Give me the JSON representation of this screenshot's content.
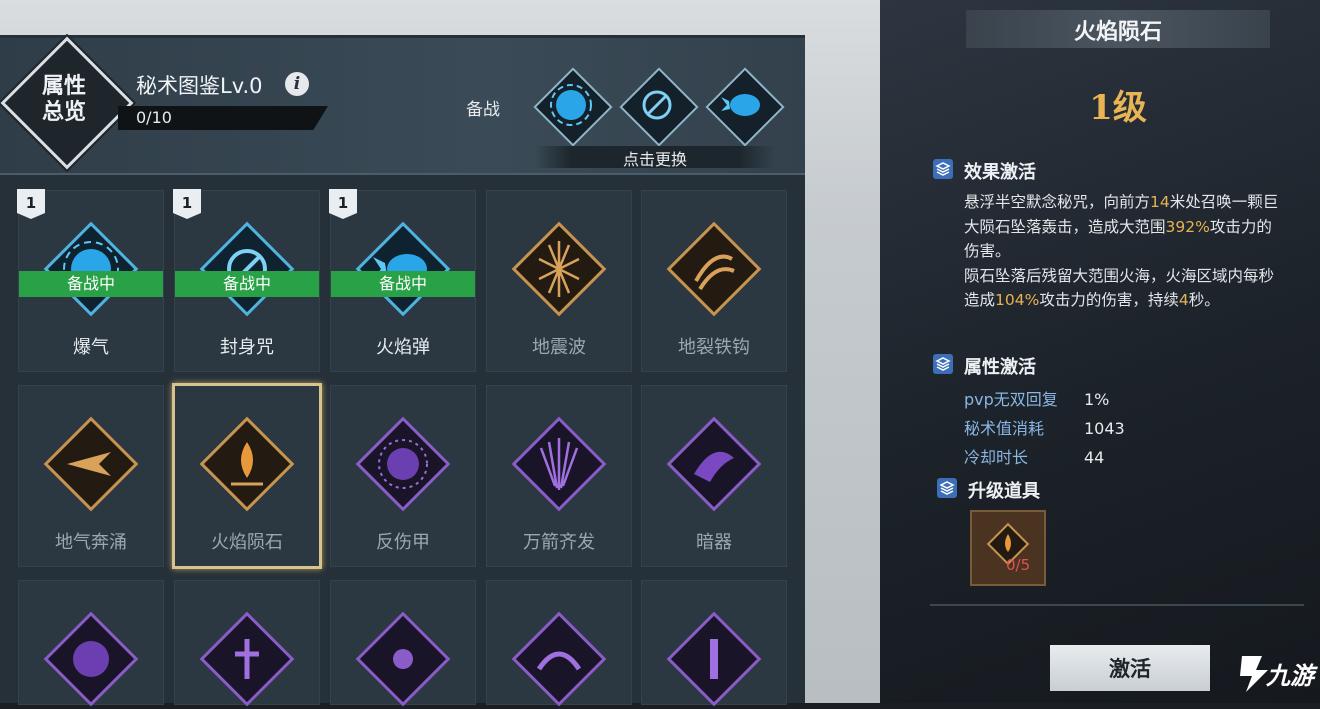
{
  "header": {
    "badge_text_line1": "属性",
    "badge_text_line2": "总览",
    "title": "秘术图鉴Lv.0",
    "progress": "0/10",
    "reserve_label": "备战",
    "change_label": "点击更换"
  },
  "colors": {
    "accent_gold": "#e6b24f",
    "ready_green": "#28a147",
    "attr_blue": "#8ab6e4",
    "count_red": "#e25050",
    "selected_border": "#d9c38d"
  },
  "grid": {
    "ready_label": "备战中",
    "level_tag": "1",
    "cards": [
      {
        "name": "爆气",
        "icon": "blue-burst-icon",
        "ready": true,
        "learned": true
      },
      {
        "name": "封身咒",
        "icon": "blue-chain-icon",
        "ready": true,
        "learned": true
      },
      {
        "name": "火焰弹",
        "icon": "blue-fireball-icon",
        "ready": true,
        "learned": true
      },
      {
        "name": "地震波",
        "icon": "gold-quake-icon",
        "ready": false,
        "learned": false
      },
      {
        "name": "地裂铁钩",
        "icon": "gold-hook-icon",
        "ready": false,
        "learned": false
      },
      {
        "name": "地气奔涌",
        "icon": "gold-surge-icon",
        "ready": false,
        "learned": false
      },
      {
        "name": "火焰陨石",
        "icon": "gold-meteor-icon",
        "ready": false,
        "learned": false,
        "selected": true
      },
      {
        "name": "反伤甲",
        "icon": "purple-armor-icon",
        "ready": false,
        "learned": false
      },
      {
        "name": "万箭齐发",
        "icon": "purple-arrows-icon",
        "ready": false,
        "learned": false
      },
      {
        "name": "暗器",
        "icon": "purple-dart-icon",
        "ready": false,
        "learned": false
      }
    ]
  },
  "detail": {
    "title": "火焰陨石",
    "level": "1级",
    "effect_title": "效果激活",
    "effect_desc": [
      {
        "t": "悬浮半空默念秘咒，向前方",
        "h": false
      },
      {
        "t": "14",
        "h": true
      },
      {
        "t": "米处召唤一颗巨大陨石坠落轰击，造成大范围",
        "h": false
      },
      {
        "t": "392%",
        "h": true
      },
      {
        "t": "攻击力的伤害。",
        "h": false
      }
    ],
    "effect_desc2": [
      {
        "t": "陨石坠落后残留大范围火海，火海区域内每秒造成",
        "h": false
      },
      {
        "t": "104%",
        "h": true
      },
      {
        "t": "攻击力的伤害，持续",
        "h": false
      },
      {
        "t": "4",
        "h": true
      },
      {
        "t": "秒。",
        "h": false
      }
    ],
    "attr_title": "属性激活",
    "attrs": [
      {
        "key": "pvp无双回复",
        "value": "1%"
      },
      {
        "key": "秘术值消耗",
        "value": "1043"
      },
      {
        "key": "冷却时长",
        "value": "44"
      }
    ],
    "upgrade_title": "升级道具",
    "item_count": "0/5",
    "activate_label": "激活"
  },
  "watermark": {
    "text": "九游"
  }
}
